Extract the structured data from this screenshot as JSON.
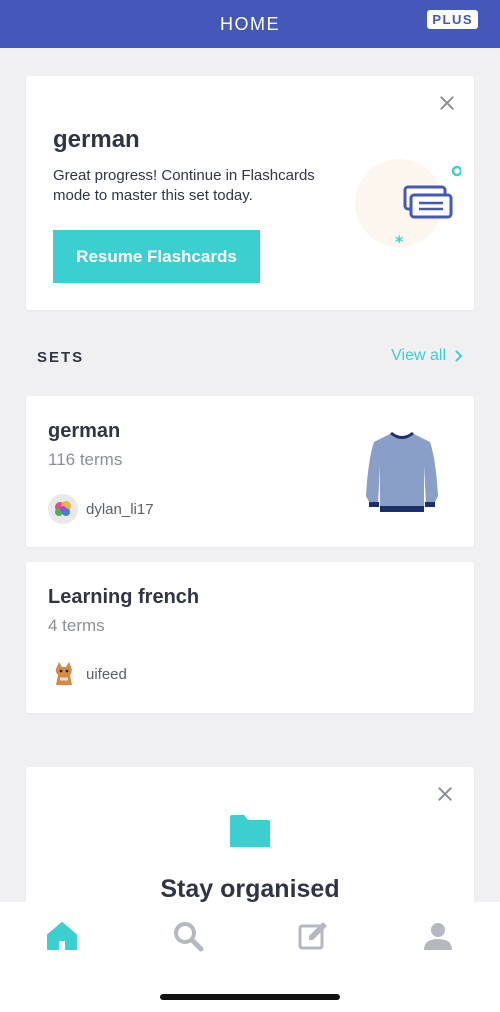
{
  "header": {
    "title": "HOME",
    "badge": "PLUS",
    "color": "#4458b9"
  },
  "promo": {
    "title": "german",
    "description": "Great progress! Continue in Flashcards mode to master this set today.",
    "button_label": "Resume Flashcards",
    "accent": "#3ccfcf"
  },
  "sets": {
    "header": "SETS",
    "view_all": "View all",
    "items": [
      {
        "title": "german",
        "terms": "116 terms",
        "author": "dylan_li17",
        "avatar_icon": "brain-icon",
        "thumb_icon": "sweater-icon"
      },
      {
        "title": "Learning french",
        "terms": "4 terms",
        "author": "uifeed",
        "avatar_icon": "kitten-icon"
      }
    ]
  },
  "organise": {
    "title": "Stay organised",
    "icon": "folder-icon"
  },
  "nav": {
    "items": [
      {
        "name": "home",
        "icon": "home-icon",
        "active": true
      },
      {
        "name": "search",
        "icon": "search-icon",
        "active": false
      },
      {
        "name": "create",
        "icon": "edit-icon",
        "active": false
      },
      {
        "name": "profile",
        "icon": "profile-icon",
        "active": false
      }
    ]
  }
}
